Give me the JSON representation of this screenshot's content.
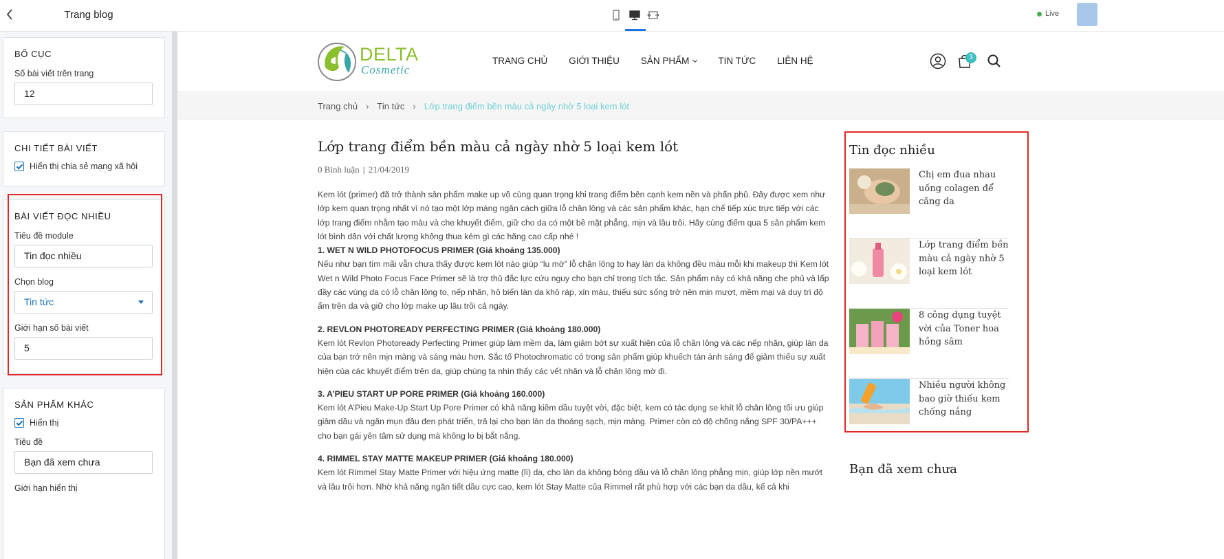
{
  "editor": {
    "title": "Trang blog",
    "layout_card": {
      "title": "BỐ CỤC",
      "posts_per_page_label": "Số bài viết trên trang",
      "posts_per_page_value": "12"
    },
    "detail_card": {
      "title": "CHI TIẾT BÀI VIẾT",
      "share_label": "Hiển thị chia sẻ mạng xã hội",
      "share_checked": true
    },
    "popular_card": {
      "title": "BÀI VIẾT ĐỌC NHIỀU",
      "module_title_label": "Tiêu đề module",
      "module_title_value": "Tin đọc nhiều",
      "blog_label": "Chọn blog",
      "blog_value": "Tin tức",
      "limit_label": "Giới hạn số bài viết",
      "limit_value": "5"
    },
    "other_products_card": {
      "title": "SẢN PHẨM KHÁC",
      "show_label": "Hiển thị",
      "show_checked": true,
      "title_label": "Tiêu đề",
      "title_value": "Bạn đã xem chưa",
      "limit_label": "Giới hạn hiển thị"
    }
  },
  "toolbar": {
    "devices": [
      "mobile-icon",
      "desktop-icon",
      "fullwidth-icon"
    ],
    "active_device": "desktop",
    "live_label": "Live",
    "accent": "#1a73e8"
  },
  "site": {
    "logo": {
      "brand": "DELTA",
      "sub": "Cosmetic"
    },
    "nav": [
      "TRANG CHỦ",
      "GIỚI THIỆU",
      "SẢN PHẨM",
      "TIN TỨC",
      "LIÊN HỆ"
    ],
    "cart_count": "3",
    "breadcrumb": {
      "home": "Trang chủ",
      "section": "Tin tức",
      "current": "Lớp trang điểm bền màu cả ngày nhờ 5 loại kem lót"
    },
    "article": {
      "title": "Lớp trang điểm bền màu cả ngày nhờ 5 loại kem lót",
      "comments": "0  Bình luận",
      "date": "21/04/2019",
      "intro": "Kem lót (primer) đã trở thành sản phẩm make up vô cùng quan trọng khi trang điểm bên cạnh kem nền và phấn phủ. Đây được xem như lớp kem quan trọng nhất vì nó tạo một lớp màng ngăn cách giữa lỗ chân lông và các sản phẩm khác, hạn chế tiếp xúc trực tiếp với các lớp trang điểm nhằm tạo màu và che khuyết điểm, giữ cho da có một bề mặt phẳng, mịn và lâu trôi. Hãy cùng điểm qua 5 sản phẩm kem lót bình dân với chất lượng không thua kém gì các hãng cao cấp nhé !",
      "sections": [
        {
          "heading": "1. WET N WILD PHOTOFOCUS PRIMER (Giá khoảng 135.000)",
          "body": "Nếu như bạn tìm mãi vẫn chưa thấy được kem lót nào giúp “lu mờ” lỗ chân lông to hay làn da không đều màu mỗi khi makeup thì Kem lót Wet n Wild Photo Focus Face Primer sẽ là trợ thủ đắc lực cứu nguy cho bạn chỉ trong tích tắc. Sản phẩm này có khả năng che phủ và lấp đầy các vùng da có lỗ chân lông to, nếp nhăn, hô biến làn da khô ráp, xỉn màu, thiếu sức sống trở nên mịn mượt, mềm mại và duy trì độ ẩm trên da và giữ cho lớp make up lâu trôi cả ngày."
        },
        {
          "heading": "2. REVLON PHOTOREADY PERFECTING PRIMER (Giá khoảng 180.000)",
          "body": "Kem lót Revlon Photoready Perfecting Primer giúp làm mềm da, làm giảm bớt sự xuất hiện của lỗ chân lông và các nếp nhăn, giúp làn da của bạn trở nên mịn màng và sáng màu hơn. Sắc tố Photochromatic có trong sản phẩm giúp khuếch tán ánh sáng để giảm thiểu sự xuất hiện của các khuyết điểm trên da, giúp chúng ta nhìn thấy các vết nhăn và lỗ chân lông mờ đi."
        },
        {
          "heading": "3. A’PIEU START UP PORE PRIMER (Giá khoảng 160.000)",
          "body": "Kem lót A’Pieu Make-Up Start Up Pore Primer có khả năng kiềm dầu tuyệt vời, đặc biệt, kem có tác dụng se khít lỗ chân lông tối ưu giúp giảm dầu và ngăn mụn đầu đen phát triển, trả lại cho bạn làn da thoáng sạch, mịn màng. Primer còn có độ chống nắng SPF 30/PA+++ cho bạn gái yên tâm sử dụng mà không lo bị bắt nắng."
        },
        {
          "heading": "4. RIMMEL STAY MATTE MAKEUP PRIMER (Giá khoảng 180.000)",
          "body": "Kem lót Rimmel Stay Matte Primer với hiệu ứng matte (lì) da, cho làn da không bóng dầu và lỗ chân lông phẳng mịn, giúp lớp nền mướt và lâu trôi hơn. Nhờ khả năng ngăn tiết dầu cực cao, kem lót Stay Matte của Rimmel rất phù hợp với các bạn da dầu, kể cả khi"
        }
      ]
    },
    "sidebar": {
      "title": "Tin đọc nhiều",
      "items": [
        {
          "title": "Chị em đua nhau uống colagen để căng da",
          "thumb": "face-mask-photo"
        },
        {
          "title": "Lớp trang điểm bền màu cả ngày nhờ 5 loại kem lót",
          "thumb": "cosmetic-bottle-photo"
        },
        {
          "title": "8 công dụng tuyệt vời của Toner hoa hồng sâm",
          "thumb": "toner-bottles-photo"
        },
        {
          "title": "Nhiều người không bao giờ thiếu kem chống nắng",
          "thumb": "sunscreen-beach-photo"
        }
      ],
      "seen_title": "Bạn đã xem chưa"
    }
  }
}
